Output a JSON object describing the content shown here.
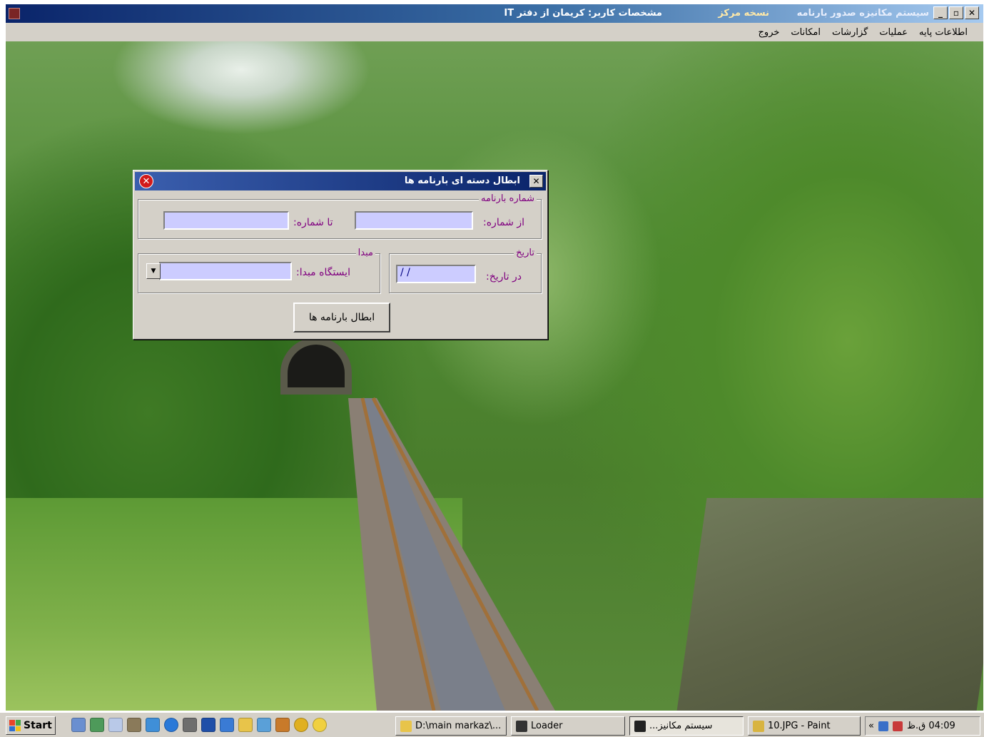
{
  "app": {
    "title": "سیستم مکانیزه صدور بارنامه",
    "version": "نسخه مرکز",
    "user_info": "مشخصات کاربر: کریمان از دفتر IT",
    "window_buttons": [
      "_",
      "▫",
      "✕"
    ]
  },
  "menu": {
    "items": [
      "اطلاعات پایه",
      "عملیات",
      "گزارشات",
      "امکانات",
      "خروج"
    ]
  },
  "dialog": {
    "title": "ابطال دسته ای بارنامه ها",
    "close_label": "✕",
    "error_icon_label": "✕",
    "group_number": {
      "caption": "شماره بارنامه",
      "from_label": "از شماره:",
      "from_value": "",
      "to_label": "تا شماره:",
      "to_value": ""
    },
    "group_origin": {
      "caption": "مبدا",
      "station_label": "ایستگاه مبدا:",
      "station_value": ""
    },
    "group_date": {
      "caption": "تاریخ",
      "date_label": "در تاریخ:",
      "date_value": " / /"
    },
    "action_button": "ابطال بارنامه ها"
  },
  "taskbar": {
    "start_label": "Start",
    "tasks": [
      {
        "label": "D:\\main markaz\\...",
        "icon": "folder-icon"
      },
      {
        "label": "Loader",
        "icon": "loader-icon"
      },
      {
        "label": "...سیستم مکانیز",
        "icon": "app-icon"
      },
      {
        "label": "10.JPG - Paint",
        "icon": "paint-icon"
      }
    ],
    "tray_expand": "«",
    "clock": "04:09 ق.ظ"
  }
}
